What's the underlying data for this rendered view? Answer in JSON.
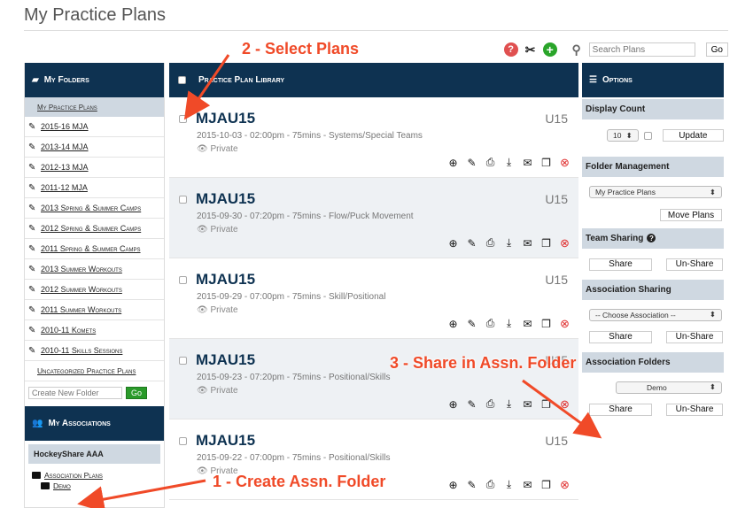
{
  "page_title": "My Practice Plans",
  "toolbar": {
    "search_placeholder": "Search Plans",
    "go_label": "Go",
    "icons": [
      "help-icon",
      "tools-icon",
      "add-icon",
      "search-icon"
    ]
  },
  "left": {
    "folders_title": "My Folders",
    "selected_folder": "My Practice Plans",
    "folders": [
      "2015-16 MJA",
      "2013-14 MJA",
      "2012-13 MJA",
      "2011-12 MJA",
      "2013 Spring & Summer Camps",
      "2012 Spring & Summer Camps",
      "2011 Spring & Summer Camps",
      "2013 Summer Workouts",
      "2012 Summer Workouts",
      "2011 Summer Workouts",
      "2010-11 Komets",
      "2010-11 Skills Sessions"
    ],
    "uncategorized": "Uncategorized Practice Plans",
    "new_folder_placeholder": "Create New Folder",
    "new_folder_go": "Go",
    "associations_title": "My Associations",
    "association_name": "HockeyShare AAA",
    "association_plans": "Association Plans",
    "association_folder": "Demo"
  },
  "library": {
    "title": "Practice Plan Library",
    "plans": [
      {
        "name": "MJAU15",
        "level": "U15",
        "desc": "2015-10-03 - 02:00pm - 75mins - Systems/Special Teams",
        "privacy": "Private"
      },
      {
        "name": "MJAU15",
        "level": "U15",
        "desc": "2015-09-30 - 07:20pm - 75mins - Flow/Puck Movement",
        "privacy": "Private"
      },
      {
        "name": "MJAU15",
        "level": "U15",
        "desc": "2015-09-29 - 07:00pm - 75mins - Skill/Positional",
        "privacy": "Private"
      },
      {
        "name": "MJAU15",
        "level": "U15",
        "desc": "2015-09-23 - 07:20pm - 75mins - Positional/Skills",
        "privacy": "Private"
      },
      {
        "name": "MJAU15",
        "level": "U15",
        "desc": "2015-09-22 - 07:00pm - 75mins - Positional/Skills",
        "privacy": "Private"
      }
    ]
  },
  "options": {
    "title": "Options",
    "display_count_label": "Display Count",
    "display_count_value": "10",
    "update_label": "Update",
    "folder_mgmt_label": "Folder Management",
    "folder_select_value": "My Practice Plans",
    "move_plans_label": "Move Plans",
    "team_sharing_label": "Team Sharing",
    "share_label": "Share",
    "unshare_label": "Un-Share",
    "assoc_sharing_label": "Association Sharing",
    "assoc_select_value": "-- Choose Association --",
    "assoc_folders_label": "Association Folders",
    "assoc_folder_value": "Demo"
  },
  "annotations": {
    "step1": "1 - Create Assn. Folder",
    "step2": "2 - Select Plans",
    "step3": "3 - Share in Assn. Folder"
  },
  "colors": {
    "header_bg": "#0e3251",
    "annotation": "#f04a28",
    "section_bg": "#cfd8e1"
  }
}
